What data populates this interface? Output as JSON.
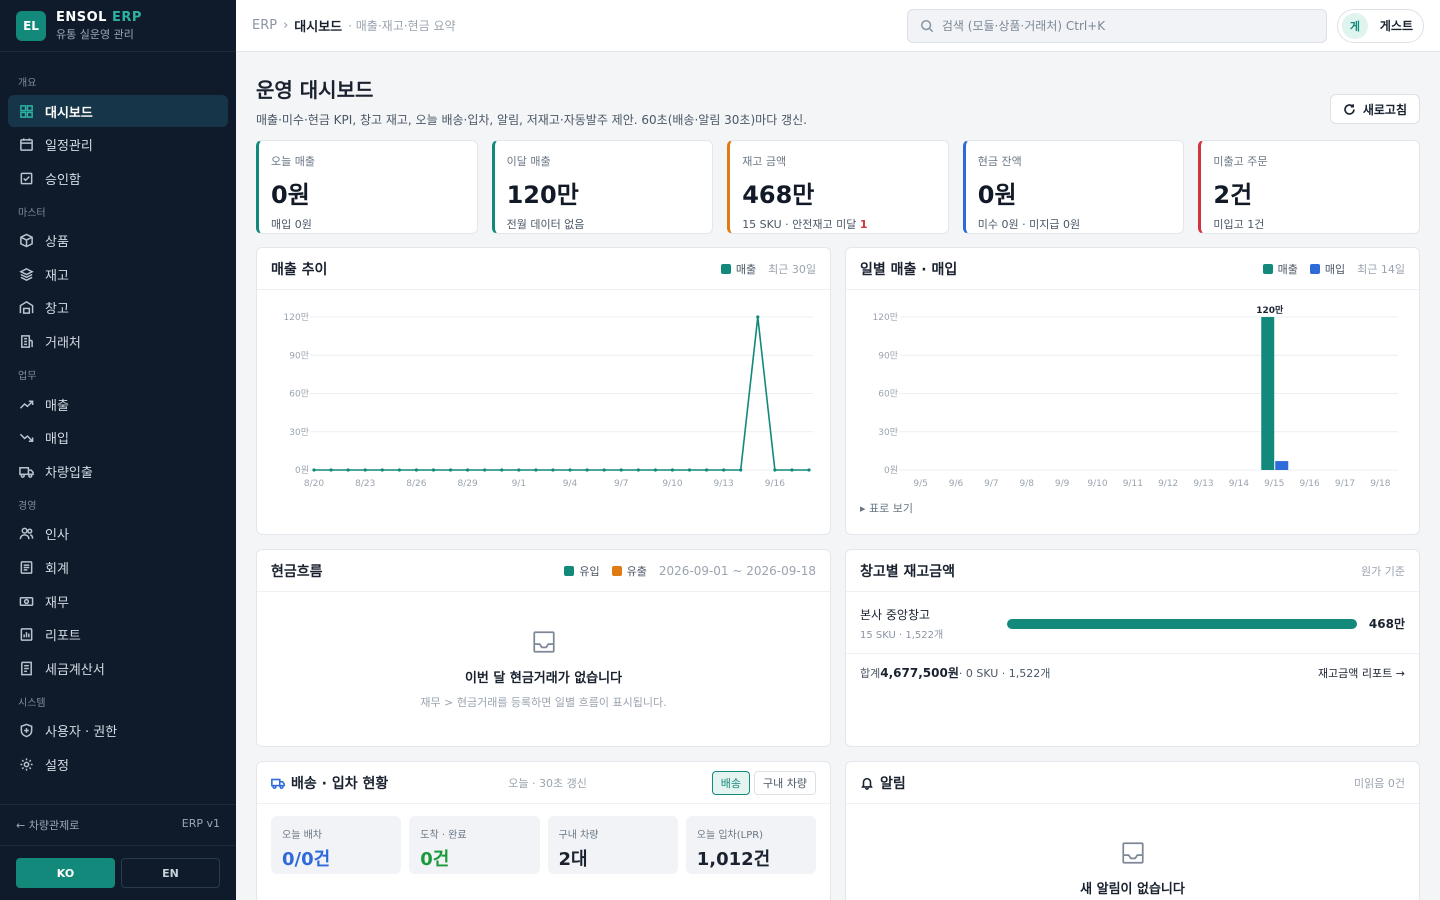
{
  "brand": {
    "logo": "EL",
    "name": "ENSOL",
    "name_accent": "ERP",
    "subtitle": "유통 실운영 관리"
  },
  "nav": {
    "sections": [
      {
        "label": "개요",
        "items": [
          {
            "label": "대시보드",
            "icon": "dashboard-icon",
            "active": true
          },
          {
            "label": "일정관리",
            "icon": "calendar-icon"
          },
          {
            "label": "승인함",
            "icon": "approval-icon"
          }
        ]
      },
      {
        "label": "마스터",
        "items": [
          {
            "label": "상품",
            "icon": "box-icon"
          },
          {
            "label": "재고",
            "icon": "layers-icon"
          },
          {
            "label": "창고",
            "icon": "warehouse-icon"
          },
          {
            "label": "거래처",
            "icon": "building-icon"
          }
        ]
      },
      {
        "label": "업무",
        "items": [
          {
            "label": "매출",
            "icon": "trend-up-icon"
          },
          {
            "label": "매입",
            "icon": "trend-down-icon"
          },
          {
            "label": "차량입출",
            "icon": "truck-icon"
          }
        ]
      },
      {
        "label": "경영",
        "items": [
          {
            "label": "인사",
            "icon": "users-icon"
          },
          {
            "label": "회계",
            "icon": "ledger-icon"
          },
          {
            "label": "재무",
            "icon": "money-icon"
          },
          {
            "label": "리포트",
            "icon": "report-icon"
          },
          {
            "label": "세금계산서",
            "icon": "invoice-icon"
          }
        ]
      },
      {
        "label": "시스템",
        "items": [
          {
            "label": "사용자 · 권한",
            "icon": "shield-icon"
          },
          {
            "label": "설정",
            "icon": "gear-icon"
          }
        ]
      }
    ],
    "back_link": "← 차량관제로",
    "version": "ERP v1",
    "lang": [
      "KO",
      "EN"
    ]
  },
  "topbar": {
    "crumb_root": "ERP",
    "crumb_sep": "›",
    "crumb_current": "대시보드",
    "crumb_desc": "· 매출·재고·현금 요약",
    "search_placeholder": "검색 (모듈·상품·거래처)  Ctrl+K",
    "user_initial": "게",
    "user_name": "게스트"
  },
  "page": {
    "title": "운영 대시보드",
    "subtitle": "매출·미수·현금 KPI, 창고 재고, 오늘 배송·입차, 알림, 저재고·자동발주 제안. 60초(배송·알림 30초)마다 갱신.",
    "refresh": "새로고침"
  },
  "kpis": [
    {
      "label": "오늘 매출",
      "value": "0원",
      "foot": "매입 0원",
      "accent": "#12897a"
    },
    {
      "label": "이달 매출",
      "value": "120만",
      "foot": "전월 데이터 없음",
      "accent": "#12897a"
    },
    {
      "label": "재고 금액",
      "value": "468만",
      "foot": "15 SKU · 안전재고 미달 ",
      "foot_warn": "1",
      "accent": "#e07b12"
    },
    {
      "label": "현금 잔액",
      "value": "0원",
      "foot": "미수 0원 · 미지급 0원",
      "accent": "#2f6ad9"
    },
    {
      "label": "미출고 주문",
      "value": "2건",
      "foot": "미입고 1건",
      "accent": "#d1343d"
    }
  ],
  "sales_trend": {
    "title": "매출 추이",
    "legend": "매출",
    "period": "최근 30일"
  },
  "daily": {
    "title": "일별 매출 · 매입",
    "legend_sales": "매출",
    "legend_purchase": "매입",
    "period": "최근 14일",
    "table_toggle": "▸ 표로 보기"
  },
  "chart_data": [
    {
      "type": "line",
      "title": "매출 추이",
      "series": [
        {
          "name": "매출",
          "color": "#12897a",
          "values": [
            0,
            0,
            0,
            0,
            0,
            0,
            0,
            0,
            0,
            0,
            0,
            0,
            0,
            0,
            0,
            0,
            0,
            0,
            0,
            0,
            0,
            0,
            0,
            0,
            0,
            0,
            1200000,
            0,
            0,
            0
          ]
        }
      ],
      "x": [
        "8/20",
        "8/21",
        "8/22",
        "8/23",
        "8/24",
        "8/25",
        "8/26",
        "8/27",
        "8/28",
        "8/29",
        "8/30",
        "8/31",
        "9/1",
        "9/2",
        "9/3",
        "9/4",
        "9/5",
        "9/6",
        "9/7",
        "9/8",
        "9/9",
        "9/10",
        "9/11",
        "9/12",
        "9/13",
        "9/14",
        "9/15",
        "9/16",
        "9/17",
        "9/18"
      ],
      "xtick_labels": [
        "8/20",
        "8/23",
        "8/26",
        "8/29",
        "9/1",
        "9/4",
        "9/7",
        "9/10",
        "9/13",
        "9/16"
      ],
      "ytick_labels": [
        "0원",
        "30만",
        "60만",
        "90만",
        "120만"
      ],
      "ylim": [
        0,
        1200000
      ],
      "grid": true
    },
    {
      "type": "bar",
      "title": "일별 매출 · 매입",
      "categories": [
        "9/5",
        "9/6",
        "9/7",
        "9/8",
        "9/9",
        "9/10",
        "9/11",
        "9/12",
        "9/13",
        "9/14",
        "9/15",
        "9/16",
        "9/17",
        "9/18"
      ],
      "series": [
        {
          "name": "매출",
          "color": "#12897a",
          "values": [
            0,
            0,
            0,
            0,
            0,
            0,
            0,
            0,
            0,
            0,
            1200000,
            0,
            0,
            0
          ]
        },
        {
          "name": "매입",
          "color": "#2f6ad9",
          "values": [
            0,
            0,
            0,
            0,
            0,
            0,
            0,
            0,
            0,
            0,
            70000,
            0,
            0,
            0
          ]
        }
      ],
      "data_labels": [
        {
          "category": "9/15",
          "series": "매출",
          "text": "120만"
        }
      ],
      "ytick_labels": [
        "0원",
        "30만",
        "60만",
        "90만",
        "120만"
      ],
      "ylim": [
        0,
        1200000
      ],
      "grid": true
    }
  ],
  "cashflow": {
    "title": "현금흐름",
    "legend_in": "유입",
    "legend_out": "유출",
    "range": "2026-09-01 ~ 2026-09-18",
    "empty_title": "이번 달 현금거래가 없습니다",
    "empty_desc": "재무 > 현금거래를 등록하면 일별 흐름이 표시됩니다."
  },
  "warehouse": {
    "title": "창고별 재고금액",
    "basis": "원가 기준",
    "rows": [
      {
        "name": "본사 중앙창고",
        "sub": "15 SKU · 1,522개",
        "value": "468만",
        "share": 1.0
      }
    ],
    "total_label": "합계 ",
    "total_value": "4,677,500원",
    "total_rest": " · 0 SKU · 1,522개",
    "report_link": "재고금액 리포트 →"
  },
  "delivery": {
    "title": "배송 · 입차 현황",
    "refresh_note": "오늘 · 30초 갱신",
    "tabs": [
      "배송",
      "구내 차량"
    ],
    "stats": [
      {
        "label": "오늘 배차",
        "value": "0/0건",
        "tone": "blue"
      },
      {
        "label": "도착 · 완료",
        "value": "0건",
        "tone": "green"
      },
      {
        "label": "구내 차량",
        "value": "2대",
        "tone": ""
      },
      {
        "label": "오늘 입차(LPR)",
        "value": "1,012건",
        "tone": ""
      }
    ]
  },
  "alerts": {
    "title": "알림",
    "unread": "미읽음 0건",
    "empty_title": "새 알림이 없습니다"
  }
}
